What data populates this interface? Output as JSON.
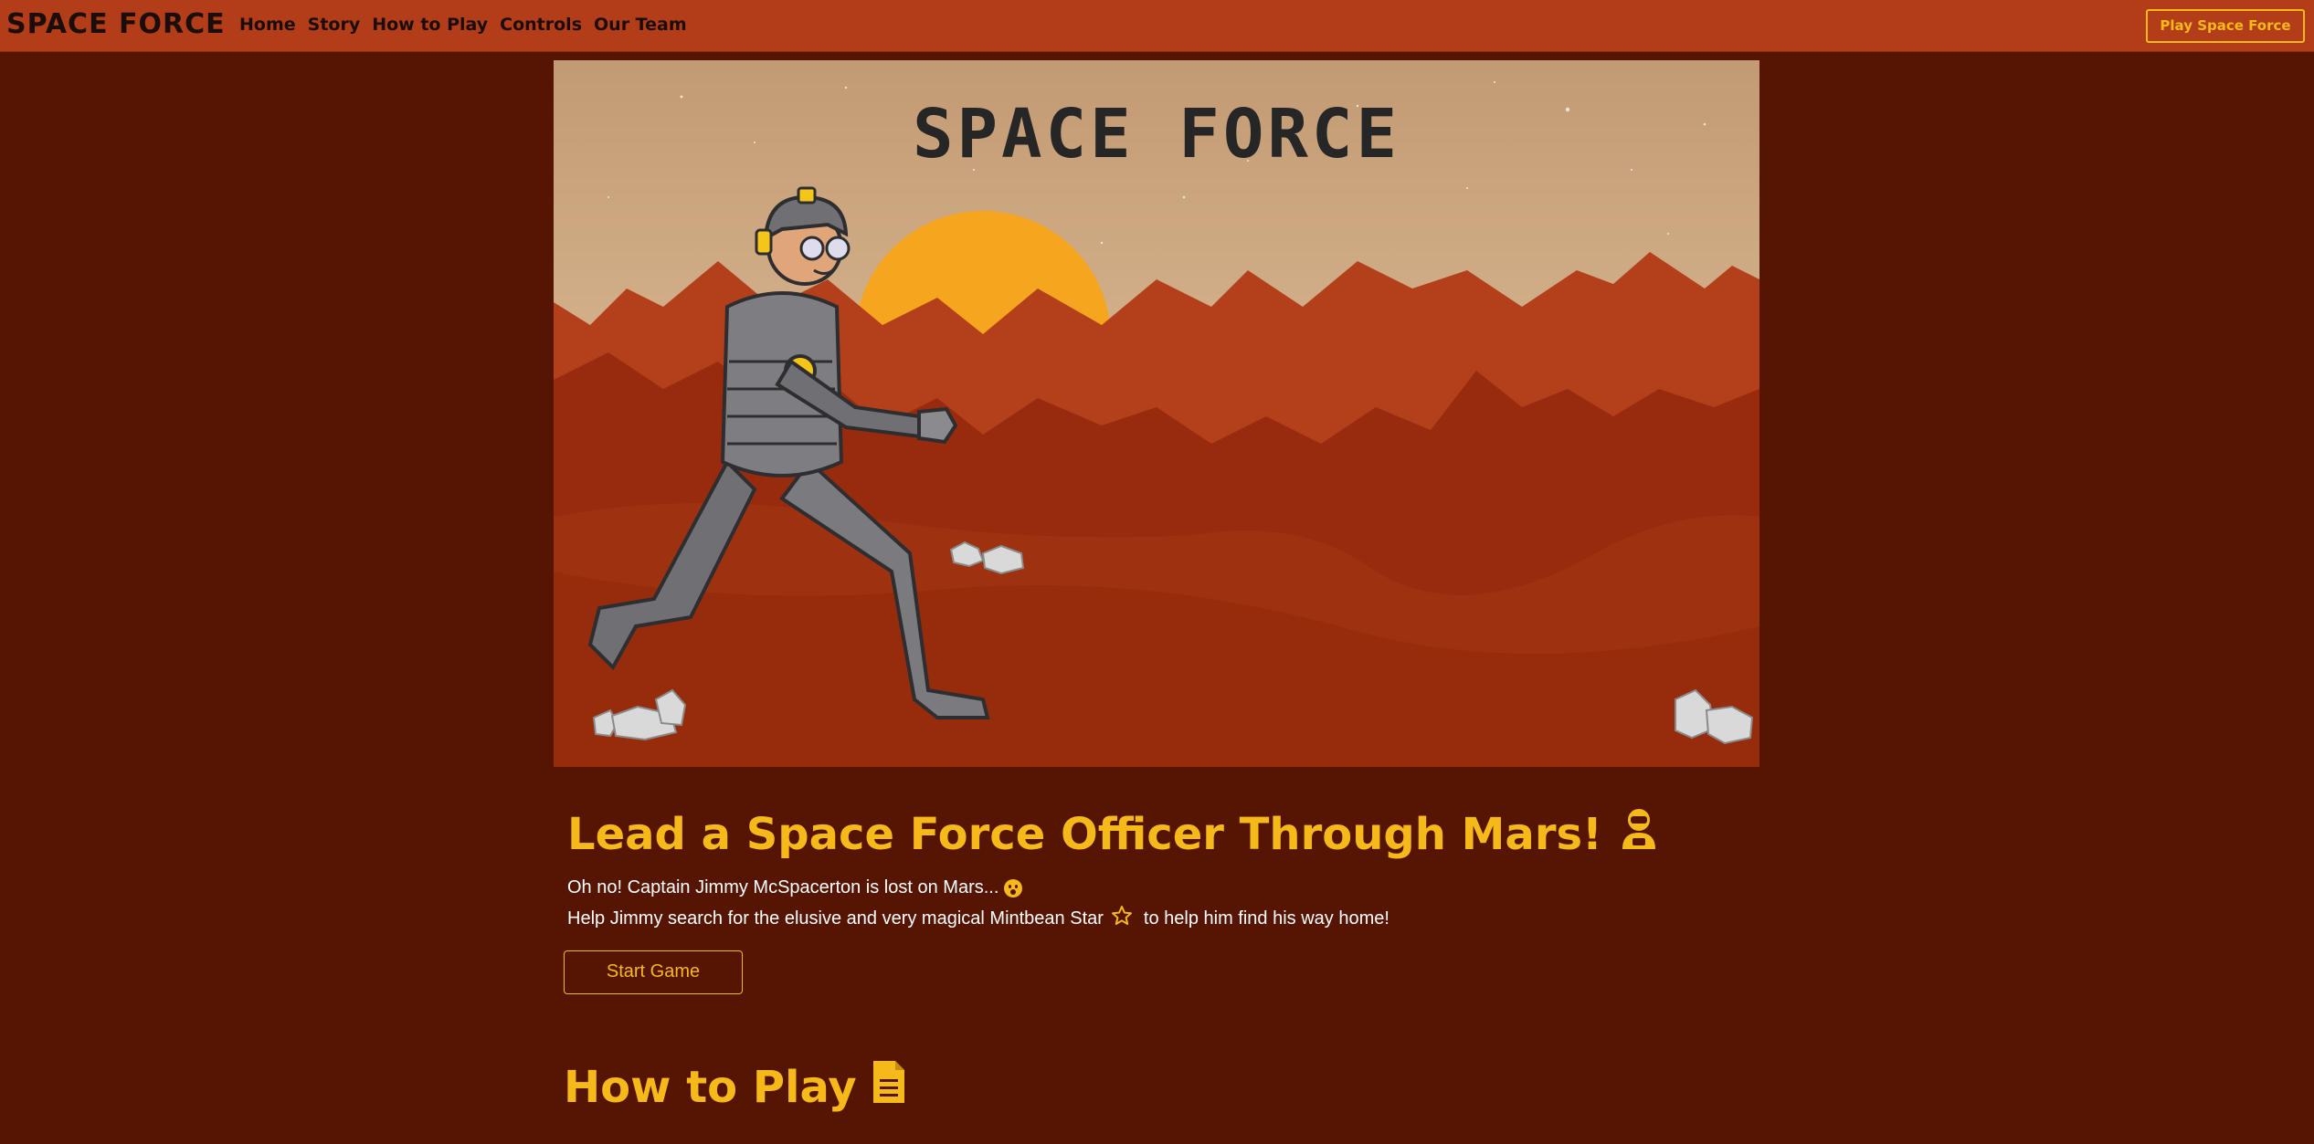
{
  "nav": {
    "brand": "SPACE FORCE",
    "links": [
      "Home",
      "Story",
      "How to Play",
      "Controls",
      "Our Team"
    ],
    "cta": "Play Space Force"
  },
  "hero": {
    "banner_title": "SPACE FORCE",
    "image_desc_icon": "astronaut-robot-illustration"
  },
  "intro": {
    "headline": "Lead a Space Force Officer Through Mars!",
    "headline_icon": "astronaut-icon",
    "line1": "Oh no! Captain Jimmy McSpacerton is lost on Mars...",
    "line1_icon": "surprised-face-icon",
    "line2_before": "Help Jimmy search for the elusive and very magical Mintbean Star",
    "line2_icon": "star-outline-icon",
    "line2_after": "to help him find his way home!",
    "button": "Start Game"
  },
  "how_to_play": {
    "title": "How to Play",
    "icon": "document-icon"
  },
  "colors": {
    "page_bg": "#561502",
    "nav_bg": "#b33c19",
    "accent": "#f5b91a",
    "text_dark": "#1b0d0a"
  }
}
